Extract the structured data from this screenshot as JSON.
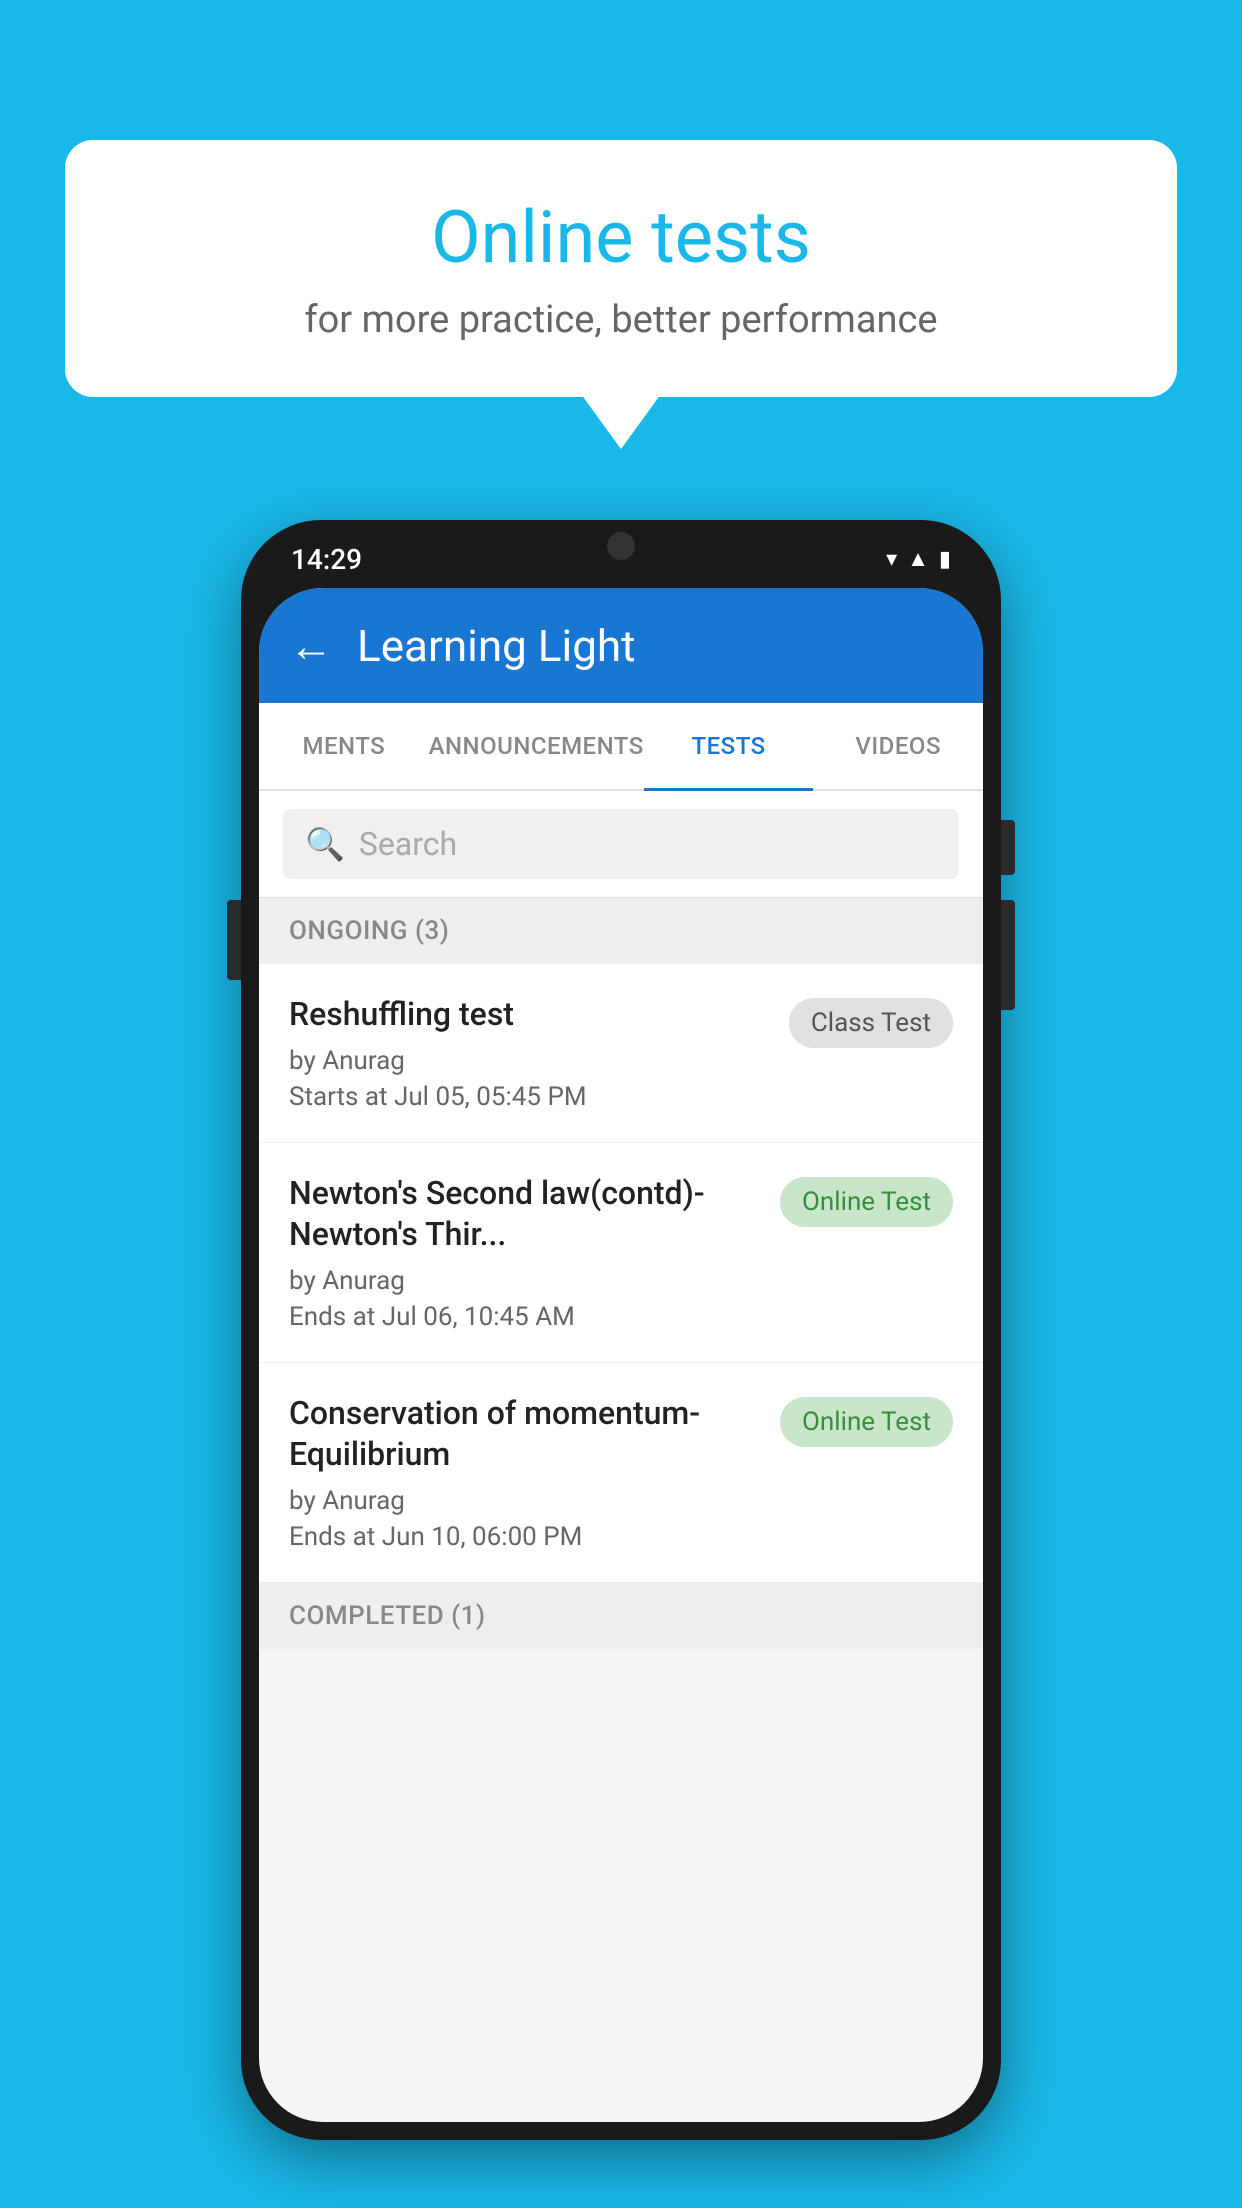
{
  "background": {
    "color": "#1ab8e8"
  },
  "speech_bubble": {
    "title": "Online tests",
    "subtitle": "for more practice, better performance"
  },
  "phone": {
    "status_bar": {
      "time": "14:29",
      "icons": [
        "wifi",
        "signal",
        "battery"
      ]
    },
    "app_header": {
      "title": "Learning Light",
      "back_label": "←"
    },
    "tabs": [
      {
        "label": "MENTS",
        "active": false
      },
      {
        "label": "ANNOUNCEMENTS",
        "active": false
      },
      {
        "label": "TESTS",
        "active": true
      },
      {
        "label": "VIDEOS",
        "active": false
      }
    ],
    "search": {
      "placeholder": "Search"
    },
    "sections": [
      {
        "header": "ONGOING (3)",
        "tests": [
          {
            "name": "Reshuffling test",
            "author": "by Anurag",
            "date": "Starts at  Jul 05, 05:45 PM",
            "badge": "Class Test",
            "badge_type": "class"
          },
          {
            "name": "Newton's Second law(contd)-Newton's Thir...",
            "author": "by Anurag",
            "date": "Ends at  Jul 06, 10:45 AM",
            "badge": "Online Test",
            "badge_type": "online"
          },
          {
            "name": "Conservation of momentum-Equilibrium",
            "author": "by Anurag",
            "date": "Ends at  Jun 10, 06:00 PM",
            "badge": "Online Test",
            "badge_type": "online"
          }
        ]
      },
      {
        "header": "COMPLETED (1)"
      }
    ]
  }
}
